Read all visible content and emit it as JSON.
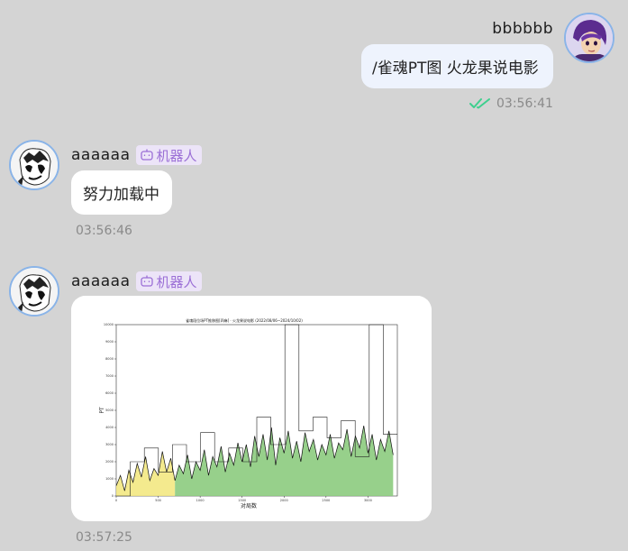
{
  "messages": [
    {
      "sender": "bbbbbb",
      "text": "/雀魂PT图 火龙果说电影",
      "time": "03:56:41",
      "status_icon": "double-check-icon",
      "status_color": "#3ecf8e"
    },
    {
      "sender": "aaaaaa",
      "badge": "机器人",
      "text": "努力加载中",
      "time": "03:56:46"
    },
    {
      "sender": "aaaaaa",
      "badge": "机器人",
      "image": "pt-chart",
      "time": "03:57:25"
    }
  ],
  "chart_data": {
    "type": "line",
    "title": "雀魂段位场PT推移图[四麻] · 火龙果说电影 (2022/08/06~2024/10/02)",
    "xlabel": "对局数",
    "ylabel": "PT",
    "xlim": [
      0,
      3350
    ],
    "ylim": [
      0,
      10000
    ],
    "x_ticks": [
      0,
      500,
      1000,
      1500,
      2000,
      2500,
      3000
    ],
    "y_ticks": [
      0,
      1000,
      2000,
      3000,
      4000,
      5000,
      6000,
      7000,
      8000,
      9000,
      10000
    ],
    "series": [
      {
        "x": [
          0,
          50,
          100,
          150,
          200,
          250,
          300,
          350,
          400,
          450,
          500,
          550,
          600,
          650,
          700,
          750,
          800,
          850,
          900,
          950,
          1000,
          1050,
          1100,
          1150,
          1200,
          1250,
          1300,
          1350,
          1400,
          1450,
          1500,
          1550,
          1600,
          1650,
          1700,
          1750,
          1800,
          1850,
          1900,
          1950,
          2000,
          2050,
          2100,
          2150,
          2200,
          2250,
          2300,
          2350,
          2400,
          2450,
          2500,
          2550,
          2600,
          2650,
          2700,
          2750,
          2800,
          2850,
          2900,
          2950,
          3000,
          3050,
          3100,
          3150,
          3200,
          3250,
          3300
        ],
        "y": [
          600,
          1200,
          300,
          1500,
          800,
          1900,
          1100,
          2300,
          900,
          1600,
          1200,
          2600,
          1400,
          2200,
          900,
          1800,
          1300,
          2400,
          1000,
          2000,
          1500,
          2700,
          1200,
          2300,
          1700,
          2900,
          1400,
          2500,
          1800,
          3100,
          2000,
          3000,
          1700,
          3500,
          2300,
          3600,
          2100,
          4000,
          1800,
          3400,
          2500,
          3800,
          2200,
          3200,
          2000,
          3700,
          2600,
          3300,
          2100,
          3000,
          2400,
          3600,
          2200,
          3100,
          2700,
          3900,
          2300,
          3500,
          2800,
          4100,
          2500,
          3600,
          2100,
          3300,
          2600,
          3800,
          2400
        ]
      }
    ],
    "rank_line_y": [
      0,
      2000,
      2800,
      1400,
      3000,
      2000,
      3700,
      2000,
      2800,
      2000,
      4600,
      3000,
      10000,
      3800,
      4600,
      3400,
      4400,
      2300,
      10000,
      3600
    ],
    "grid": false,
    "fill_colors": [
      "#f2e67a",
      "#8ccb7e"
    ]
  }
}
